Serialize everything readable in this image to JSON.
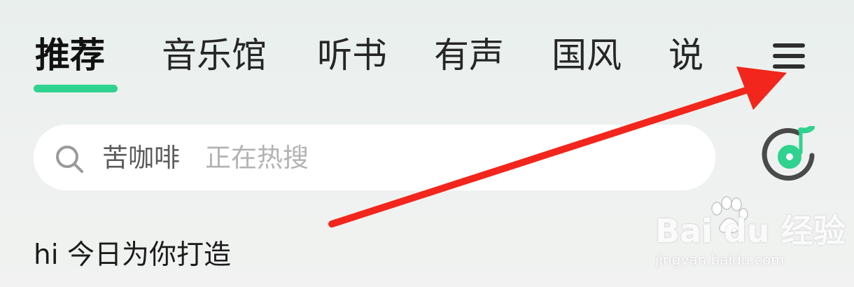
{
  "tabs": [
    {
      "label": "推荐",
      "active": true
    },
    {
      "label": "音乐馆"
    },
    {
      "label": "听书"
    },
    {
      "label": "有声"
    },
    {
      "label": "国风"
    },
    {
      "label": "说"
    }
  ],
  "search": {
    "hot_term": "苦咖啡",
    "hot_hint": "正在热搜"
  },
  "greeting": "hi 今日为你打造",
  "watermark": {
    "logo_text": "Bai du 经验",
    "url": "jingyan.baidu.com"
  },
  "colors": {
    "accent": "#2fd28f",
    "arrow": "#f2261c"
  },
  "icons": {
    "menu": "hamburger-menu-icon",
    "search": "search-icon",
    "music": "music-disc-icon"
  }
}
